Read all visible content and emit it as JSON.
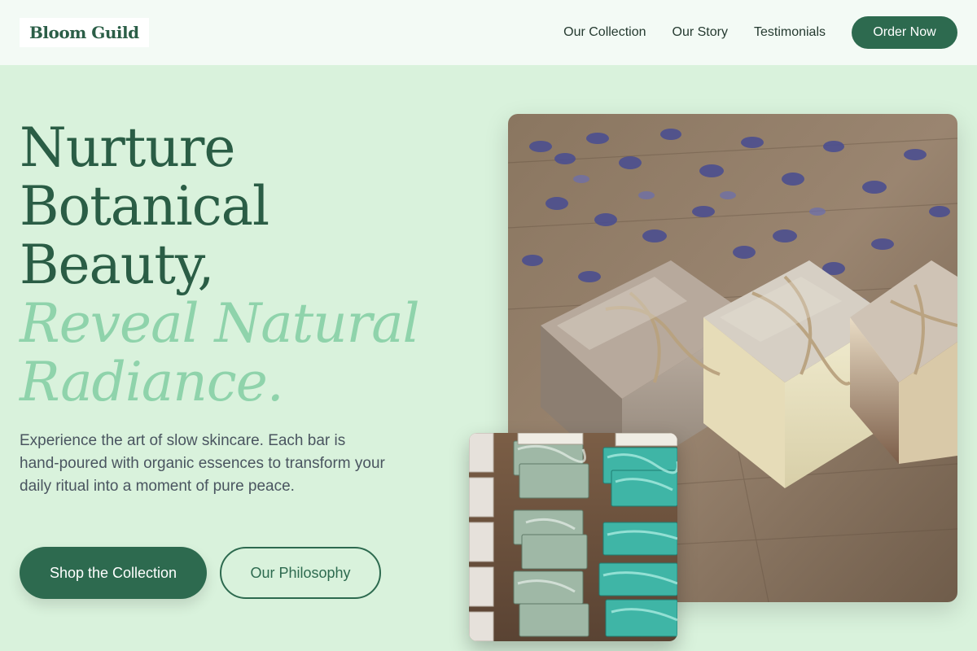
{
  "header": {
    "logo": "Bloom Guild",
    "nav": [
      "Our Collection",
      "Our Story",
      "Testimonials"
    ],
    "cta": "Order Now"
  },
  "hero": {
    "title_lines": [
      "Nurture",
      "Botanical",
      "Beauty,"
    ],
    "accent_lines": [
      "Reveal Natural",
      "Radiance."
    ],
    "description": "Experience the art of slow skincare. Each bar is hand-poured with organic essences to transform your daily ritual into a moment of pure peace.",
    "primary_button": "Shop the Collection",
    "secondary_button": "Our Philosophy"
  },
  "colors": {
    "brand": "#2d6a4f",
    "accent": "#8fd3ab",
    "background": "#d9f2dc"
  },
  "images": {
    "main_alt": "Soap bars tied with twine beside lavender",
    "inset_alt": "Green and turquoise marbled soap bars on shelves"
  }
}
